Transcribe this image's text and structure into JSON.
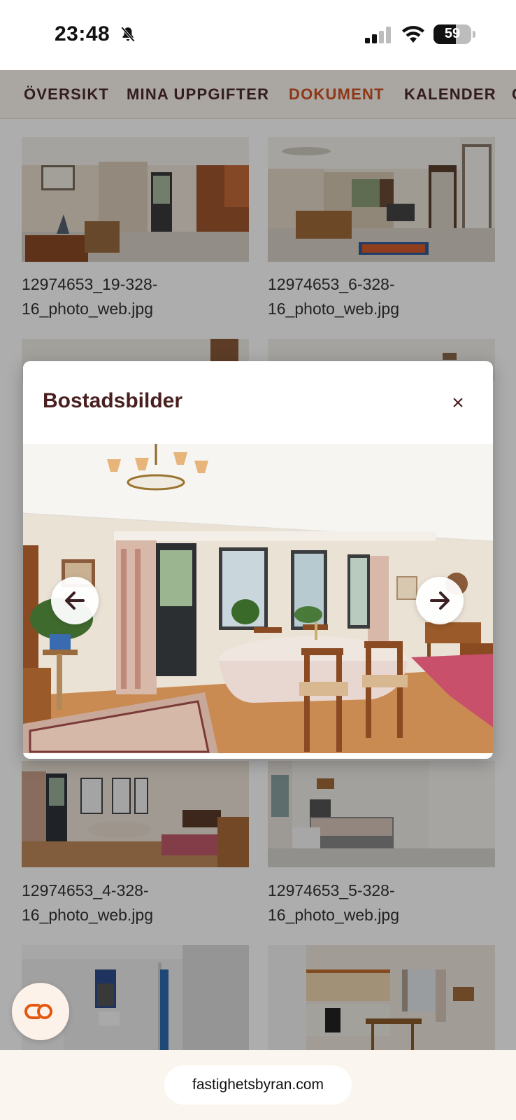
{
  "status_bar": {
    "time": "23:48",
    "battery": "59",
    "battery_level": 0.59,
    "icons": [
      "bell-slash-icon",
      "cellular-signal-icon",
      "wifi-icon",
      "battery-icon"
    ]
  },
  "nav": {
    "tabs": [
      {
        "label": "ÖVERSIKT",
        "active": false
      },
      {
        "label": "MINA UPPGIFTER",
        "active": false
      },
      {
        "label": "DOKUMENT",
        "active": true
      },
      {
        "label": "KALENDER",
        "active": false
      },
      {
        "label": "C",
        "active": false
      }
    ]
  },
  "gallery": {
    "items": [
      {
        "filename": "12974653_19-328-16_photo_web.jpg",
        "line1": "12974653_19-328-",
        "line2": "16_photo_web.jpg"
      },
      {
        "filename": "12974653_6-328-16_photo_web.jpg",
        "line1": "12974653_6-328-",
        "line2": "16_photo_web.jpg"
      },
      {
        "filename": "12974653_4-328-16_photo_web.jpg",
        "line1": "12974653_4-328-",
        "line2": "16_photo_web.jpg"
      },
      {
        "filename": "12974653_5-328-16_photo_web.jpg",
        "line1": "12974653_5-328-",
        "line2": "16_photo_web.jpg"
      }
    ]
  },
  "modal": {
    "title": "Bostadsbilder",
    "close_label": "×"
  },
  "browser": {
    "url": "fastighetsbyran.com"
  },
  "colors": {
    "accent": "#d0521f",
    "title": "#4a1f1f",
    "nav_bg": "#fbf5ef",
    "overlay": "rgba(0,0,0,0.32)"
  }
}
